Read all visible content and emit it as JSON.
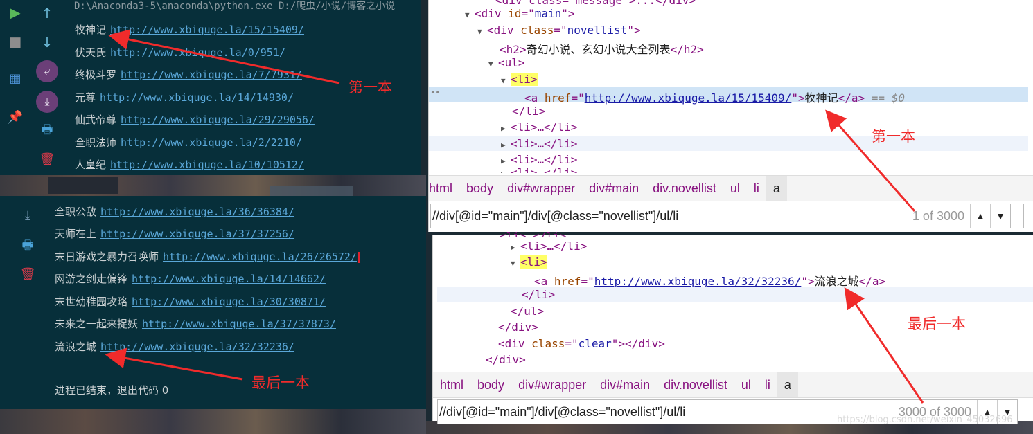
{
  "console_top": {
    "path_text": "D:\\Anaconda3-5\\anaconda\\python.exe D:/爬虫/小说/博客之小说",
    "lines": [
      {
        "title": "牧神记",
        "url": "http://www.xbiquge.la/15/15409/"
      },
      {
        "title": "伏天氏",
        "url": "http://www.xbiquge.la/0/951/"
      },
      {
        "title": "终极斗罗",
        "url": "http://www.xbiquge.la/7/7931/"
      },
      {
        "title": "元尊",
        "url": "http://www.xbiquge.la/14/14930/"
      },
      {
        "title": "仙武帝尊",
        "url": "http://www.xbiquge.la/29/29056/"
      },
      {
        "title": "全职法师",
        "url": "http://www.xbiquge.la/2/2210/"
      },
      {
        "title": "人皇纪",
        "url": "http://www.xbiquge.la/10/10512/"
      }
    ]
  },
  "console_bottom": {
    "lines": [
      {
        "title": "全职公敌",
        "url": "http://www.xbiquge.la/36/36384/"
      },
      {
        "title": "天师在上",
        "url": "http://www.xbiquge.la/37/37256/"
      },
      {
        "title": "末日游戏之暴力召唤师",
        "url": "http://www.xbiquge.la/26/26572/"
      },
      {
        "title": "网游之剑走偏锋",
        "url": "http://www.xbiquge.la/14/14662/"
      },
      {
        "title": "末世幼稚园攻略",
        "url": "http://www.xbiquge.la/30/30871/"
      },
      {
        "title": "未来之一起来捉妖",
        "url": "http://www.xbiquge.la/37/37873/"
      },
      {
        "title": "流浪之城",
        "url": "http://www.xbiquge.la/32/32236/"
      }
    ],
    "status": "进程已结束，退出代码 0"
  },
  "devtools_top": {
    "div_main": {
      "tag": "div",
      "attr": "id",
      "value": "main"
    },
    "div_list": {
      "tag": "div",
      "attr": "class",
      "value": "novellist"
    },
    "h2_text": "奇幻小说、玄幻小说大全列表",
    "a_href": "http://www.xbiquge.la/15/15409/",
    "a_text": "牧神记",
    "selected_marker": "== $0",
    "collapsed_li": "<li>…</li>",
    "breadcrumbs": [
      "html",
      "body",
      "div#wrapper",
      "div#main",
      "div.novellist",
      "ul",
      "li",
      "a"
    ],
    "search_query": "//div[@id=\"main\"]/div[@class=\"novellist\"]/ul/li",
    "search_count": "1 of 3000"
  },
  "devtools_bottom": {
    "a_href": "http://www.xbiquge.la/32/32236/",
    "a_text": "流浪之城",
    "collapsed_li": "<li>…</li>",
    "clear_class": "clear",
    "breadcrumbs": [
      "html",
      "body",
      "div#wrapper",
      "div#main",
      "div.novellist",
      "ul",
      "li",
      "a"
    ],
    "search_query": "//div[@id=\"main\"]/div[@class=\"novellist\"]/ul/li",
    "search_count": "3000 of 3000"
  },
  "annotations": {
    "first_left": "第一本",
    "first_right": "第一本",
    "last_left": "最后一本",
    "last_right": "最后一本"
  },
  "watermark": "https://blog.csdn.net/weixin_45032696",
  "colors": {
    "annotation_red": "#f02b2b",
    "console_bg": "#072f3a",
    "url_blue": "#5aa7d8"
  }
}
